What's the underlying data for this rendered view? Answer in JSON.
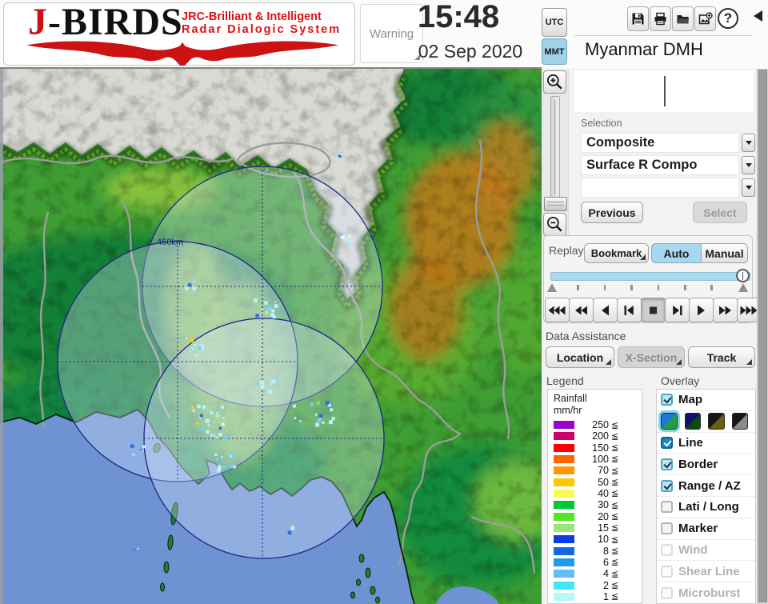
{
  "header": {
    "logo": {
      "title_j": "J",
      "title_rest": "-BIRDS",
      "tagline1": "JRC-Brilliant & Intelligent",
      "tagline2": "Radar Dialogic System"
    },
    "warning_label": "Warning",
    "time": "15:48",
    "date": "02 Sep 2020",
    "timezones": {
      "utc": "UTC",
      "mmt": "MMT",
      "active": "MMT"
    },
    "toolbar": {
      "help_glyph": "?",
      "buttons": [
        "save",
        "print",
        "open-folder",
        "add-image",
        "help"
      ]
    }
  },
  "panel": {
    "title": "Myanmar DMH",
    "selection": {
      "label": "Selection",
      "dropdowns": [
        {
          "value": "Composite"
        },
        {
          "value": "Surface R Compo"
        },
        {
          "value": ""
        }
      ],
      "previous_label": "Previous",
      "select_label": "Select"
    },
    "replay": {
      "label": "Replay",
      "bookmark_label": "Bookmark",
      "auto_label": "Auto",
      "manual_label": "Manual",
      "active_mode": "Auto",
      "slider_position": 1.0,
      "playback": [
        "rewind-fast",
        "rewind",
        "play-reverse",
        "step-back",
        "stop",
        "step-forward",
        "play",
        "forward",
        "forward-fast"
      ],
      "active_playback": "stop"
    },
    "data_assistance": {
      "label": "Data Assistance",
      "buttons": [
        {
          "label": "Location",
          "enabled": true
        },
        {
          "label": "X-Section",
          "enabled": false
        },
        {
          "label": "Track",
          "enabled": true
        }
      ]
    },
    "legend": {
      "label": "Legend",
      "title1": "Rainfall",
      "title2": "mm/hr",
      "lte": "≦",
      "rows": [
        {
          "value": "250",
          "color": "#9900cc"
        },
        {
          "value": "200",
          "color": "#cc0066"
        },
        {
          "value": "150",
          "color": "#fa0000"
        },
        {
          "value": "100",
          "color": "#ff6400"
        },
        {
          "value": "70",
          "color": "#ff9800"
        },
        {
          "value": "50",
          "color": "#ffc800"
        },
        {
          "value": "40",
          "color": "#fafa50"
        },
        {
          "value": "30",
          "color": "#00c832"
        },
        {
          "value": "20",
          "color": "#50e622"
        },
        {
          "value": "15",
          "color": "#9ae67e"
        },
        {
          "value": "10",
          "color": "#0a3ce6"
        },
        {
          "value": "8",
          "color": "#1468e6"
        },
        {
          "value": "6",
          "color": "#1e9af0"
        },
        {
          "value": "4",
          "color": "#64bef0"
        },
        {
          "value": "2",
          "color": "#3ce8fa"
        },
        {
          "value": "1",
          "color": "#b4fafa"
        }
      ]
    },
    "overlay": {
      "label": "Overlay",
      "items": [
        {
          "type": "checkbox",
          "label": "Map",
          "checked": true,
          "disabled": false
        },
        {
          "type": "styles",
          "styles": [
            {
              "c1": "#2277dd",
              "c2": "#22a040",
              "selected": true
            },
            {
              "c1": "#10106e",
              "c2": "#0d4a0d",
              "selected": false
            },
            {
              "c1": "#151515",
              "c2": "#6e5e10",
              "selected": false
            },
            {
              "c1": "#151515",
              "c2": "#8a8a8a",
              "selected": false
            }
          ]
        },
        {
          "type": "checkbox",
          "label": "Line",
          "checked": true,
          "disabled": false,
          "variant": "deep"
        },
        {
          "type": "checkbox",
          "label": "Border",
          "checked": true,
          "disabled": false
        },
        {
          "type": "checkbox",
          "label": "Range / AZ",
          "checked": true,
          "disabled": false
        },
        {
          "type": "checkbox",
          "label": "Lati / Long",
          "checked": false,
          "disabled": false
        },
        {
          "type": "checkbox",
          "label": "Marker",
          "checked": false,
          "disabled": false
        },
        {
          "type": "checkbox",
          "label": "Wind",
          "checked": false,
          "disabled": true
        },
        {
          "type": "checkbox",
          "label": "Shear Line",
          "checked": false,
          "disabled": true
        },
        {
          "type": "checkbox",
          "label": "Microburst",
          "checked": false,
          "disabled": true
        }
      ]
    }
  },
  "map": {
    "range_label": "450km",
    "sea_color": "#6e92d2",
    "circle_stroke": "#1b2688"
  }
}
